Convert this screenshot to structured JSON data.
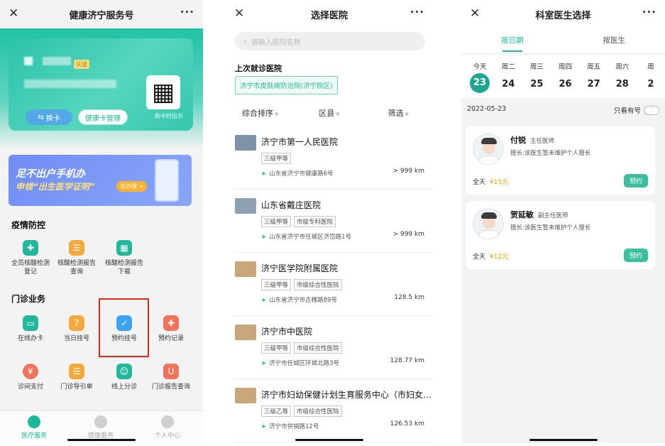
{
  "phone1": {
    "title": "健康济宁服务号",
    "close": "✕",
    "more": "···",
    "card": {
      "badge": "认证",
      "switch_card": "换卡",
      "manage": "健康卡管理",
      "qr_caption": "刷卡时出示"
    },
    "banner": {
      "line1": "足不出户手机办",
      "line2": "申领“出生医学证明”",
      "go": "去办理 >"
    },
    "epidemic": {
      "title": "疫情防控",
      "items": [
        {
          "label": "全员核酸检测登记",
          "icon": "test-tube-icon",
          "color": "#23b79b"
        },
        {
          "label": "核酸检测报告查询",
          "icon": "report-search-icon",
          "color": "#f5a93a"
        },
        {
          "label": "核酸检测报告下载",
          "icon": "grid-download-icon",
          "color": "#23b79b"
        }
      ]
    },
    "outpatient": {
      "title": "门诊业务",
      "items": [
        {
          "label": "在线办卡",
          "icon": "card-icon",
          "color": "#23b79b"
        },
        {
          "label": "当日挂号",
          "icon": "calendar-today-icon",
          "color": "#f5a93a"
        },
        {
          "label": "预约挂号",
          "icon": "calendar-check-icon",
          "color": "#3aa4f0"
        },
        {
          "label": "预约记录",
          "icon": "plus-record-icon",
          "color": "#f0745a"
        },
        {
          "label": "诊间支付",
          "icon": "pay-icon",
          "color": "#f0745a"
        },
        {
          "label": "门诊导引单",
          "icon": "guide-doc-icon",
          "color": "#f5a93a"
        },
        {
          "label": "线上分诊",
          "icon": "people-icon",
          "color": "#23b79b"
        },
        {
          "label": "门诊报告查询",
          "icon": "stethoscope-icon",
          "color": "#f0745a"
        }
      ]
    },
    "tabs": [
      {
        "label": "医疗服务",
        "active": true
      },
      {
        "label": "健康服务",
        "active": false
      },
      {
        "label": "个人中心",
        "active": false
      }
    ]
  },
  "phone2": {
    "title": "选择医院",
    "search_placeholder": "请输入医院名称",
    "last_title": "上次就诊医院",
    "last_hospital": "济宁市皮肤病防治院(济宁院区)",
    "filters": [
      "综合排序",
      "区县",
      "筛选"
    ],
    "hospitals": [
      {
        "name": "济宁市第一人民医院",
        "tags": [
          "三级甲等"
        ],
        "address": "山东省济宁市健康路6号",
        "distance": "> 999 km"
      },
      {
        "name": "山东省戴庄医院",
        "tags": [
          "三级甲等",
          "市级专科医院"
        ],
        "address": "山东省济宁市任城区济岱路1号",
        "distance": "> 999 km"
      },
      {
        "name": "济宁医学院附属医院",
        "tags": [
          "三级甲等",
          "市级综合性医院"
        ],
        "address": "山东省济宁市古槐路89号",
        "distance": "128.5 km"
      },
      {
        "name": "济宁市中医院",
        "tags": [
          "三级甲等",
          "市级综合性医院"
        ],
        "address": "济宁市任城区环城北路3号",
        "distance": "128.77 km"
      },
      {
        "name": "济宁市妇幼保健计划生育服务中心（市妇女…",
        "tags": [
          "三级乙等",
          "市级综合性医院"
        ],
        "address": "济宁市供销路12号",
        "distance": "126.53 km"
      }
    ]
  },
  "phone3": {
    "title": "科室医生选择",
    "tabs": [
      "按日期",
      "按医生"
    ],
    "days": [
      {
        "week": "今天",
        "date": "23",
        "selected": true
      },
      {
        "week": "周二",
        "date": "24"
      },
      {
        "week": "周三",
        "date": "25"
      },
      {
        "week": "周四",
        "date": "26"
      },
      {
        "week": "周五",
        "date": "27"
      },
      {
        "week": "周六",
        "date": "28"
      },
      {
        "week": "周",
        "date": "2"
      }
    ],
    "date": "2022-05-23",
    "only_available": "只看有号",
    "doctors": [
      {
        "name": "付锐",
        "title": "主任医师",
        "specialty": "擅长:该医生暂未维护个人擅长",
        "session": "全天",
        "price": "¥15元",
        "book": "预约"
      },
      {
        "name": "贺延敏",
        "title": "副主任医师",
        "specialty": "擅长:该医生暂未维护个人擅长",
        "session": "全天",
        "price": "¥12元",
        "book": "预约"
      }
    ]
  }
}
